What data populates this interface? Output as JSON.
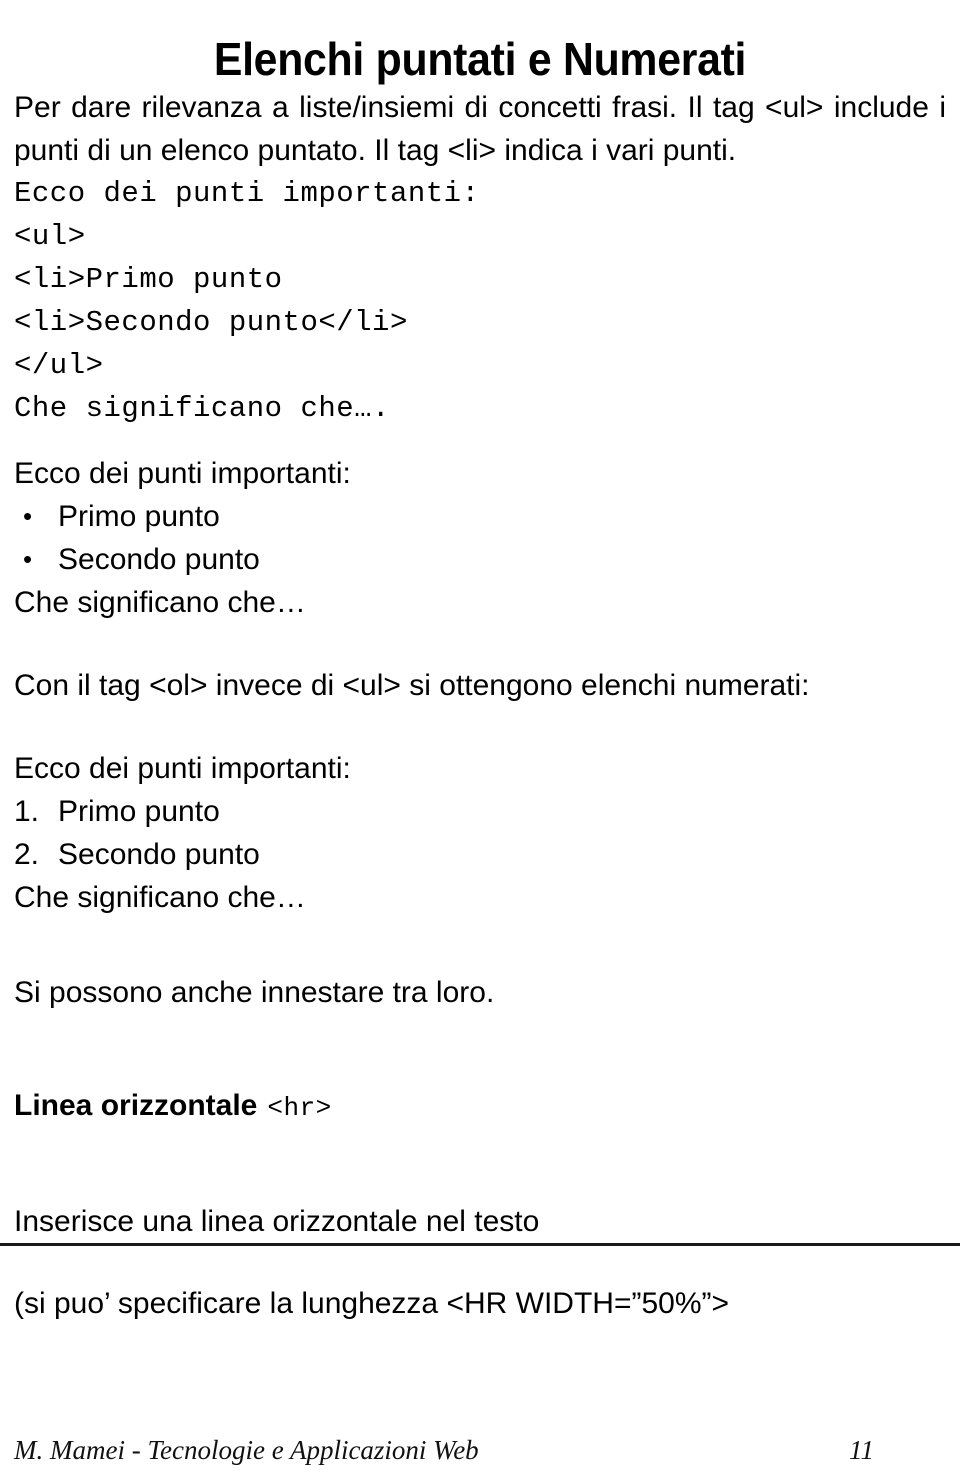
{
  "slide": {
    "title": "Elenchi puntati e Numerati",
    "intro_paragraph": "Per dare rilevanza a liste/insiemi di concetti frasi. Il tag <ul> include i punti di un elenco puntato. Il tag <li> indica i vari punti.",
    "code_sample": "Ecco dei punti importanti:\n<ul>\n<li>Primo punto\n<li>Secondo punto</li>\n</ul>\nChe significano che….",
    "bulleted_demo": {
      "lead": "Ecco dei punti importanti:",
      "items": [
        {
          "marker": "•",
          "label": "Primo punto"
        },
        {
          "marker": "•",
          "label": "Secondo punto"
        }
      ],
      "trailer": "Che significano che…"
    },
    "ol_paragraph": "Con il tag <ol> invece di <ul> si ottengono elenchi numerati:",
    "numbered_demo": {
      "lead": "Ecco dei punti importanti:",
      "items": [
        {
          "marker": "1.",
          "label": "Primo punto"
        },
        {
          "marker": "2.",
          "label": "Secondo punto"
        }
      ],
      "trailer": "Che significano che…"
    },
    "nesting_note": "Si possono anche innestare tra loro.",
    "hr_heading": {
      "text": "Linea orizzontale",
      "tag": "<hr>"
    },
    "hr_description": "Inserisce una linea orizzontale nel testo",
    "hr_width_note": "(si puo’ specificare la lunghezza <HR WIDTH=”50%”>"
  },
  "footer": {
    "credit": "M. Mamei - Tecnologie e Applicazioni Web",
    "page_number": "11"
  },
  "colors": {
    "text": "#000000",
    "rule": "#1a1a1a",
    "background": "#ffffff"
  }
}
